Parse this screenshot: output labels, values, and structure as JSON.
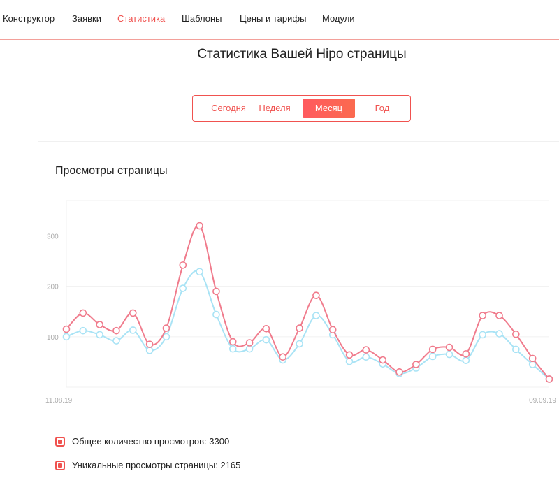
{
  "nav": {
    "items": [
      {
        "label": "Конструктор",
        "active": false
      },
      {
        "label": "Заявки",
        "active": false
      },
      {
        "label": "Статистика",
        "active": true
      },
      {
        "label": "Шаблоны",
        "active": false
      },
      {
        "label": "Цены и тарифы",
        "active": false
      },
      {
        "label": "Модули",
        "active": false
      }
    ]
  },
  "page_title": "Статистика Вашей Hipo страницы",
  "period_switch": {
    "options": [
      "Сегодня",
      "Неделя",
      "Месяц",
      "Год"
    ],
    "selected": "Месяц"
  },
  "section_title": "Просмотры страницы",
  "legend": {
    "total": "Общее количество просмотров: 3300",
    "unique": "Уникальные просмотры страницы: 2165"
  },
  "colors": {
    "accent": "#f0524f",
    "series_total": "#f07b8c",
    "series_unique": "#a9e3f5",
    "grid": "#f0f0f0",
    "tick": "#aaaaaa"
  },
  "chart_data": {
    "type": "line",
    "x_start_label": "11.08.19",
    "x_end_label": "09.09.19",
    "yticks": [
      100,
      200,
      300
    ],
    "ylim": [
      0,
      370
    ],
    "grid": true,
    "legend_position": "bottom-left",
    "series": [
      {
        "key": "total",
        "values": [
          115,
          147,
          124,
          112,
          147,
          85,
          117,
          242,
          320,
          190,
          90,
          88,
          116,
          60,
          117,
          182,
          114,
          64,
          74,
          54,
          30,
          45,
          75,
          79,
          66,
          142,
          142,
          105,
          57,
          16
        ]
      },
      {
        "key": "unique",
        "values": [
          100,
          112,
          104,
          92,
          113,
          73,
          100,
          196,
          229,
          144,
          76,
          76,
          94,
          54,
          86,
          142,
          104,
          51,
          60,
          46,
          27,
          38,
          61,
          65,
          53,
          104,
          106,
          75,
          45,
          16
        ]
      }
    ]
  }
}
